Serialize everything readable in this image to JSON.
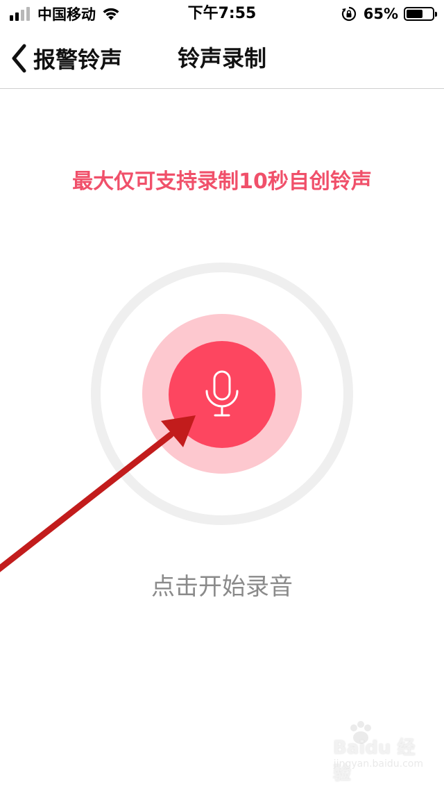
{
  "status_bar": {
    "carrier": "中国移动",
    "time": "下午7:55",
    "battery_percent_text": "65%",
    "battery_level": 0.65,
    "signal_bars_active": 2,
    "signal_bars_total": 4
  },
  "nav": {
    "back_label": "报警铃声",
    "title": "铃声录制"
  },
  "content": {
    "hint": "最大仅可支持录制10秒自创铃声",
    "start_label": "点击开始录音"
  },
  "watermark": {
    "line1": "Baidu 经验",
    "line2": "jingyan.baidu.com"
  },
  "colors": {
    "accent": "#fd4660",
    "accent_light": "#fdc8cf",
    "ring": "#efefef",
    "hint_text": "#f0506a",
    "secondary_text": "#8a8a8a",
    "annotation_arrow": "#c21c1c"
  },
  "icons": {
    "back": "chevron-left-icon",
    "mic": "microphone-icon",
    "wifi": "wifi-icon",
    "rotation_lock": "rotation-lock-icon",
    "battery": "battery-icon",
    "signal": "signal-icon"
  }
}
